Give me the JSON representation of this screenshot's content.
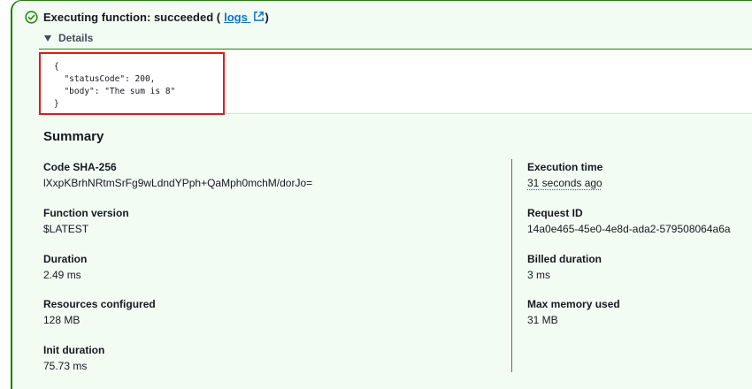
{
  "status": {
    "text": "Executing function: succeeded (",
    "link_label": "logs",
    "suffix": ")",
    "icon": "check-circle-icon",
    "external_icon": "external-link-icon"
  },
  "details": {
    "label": "Details"
  },
  "code": {
    "lines": "{\n  \"statusCode\": 200,\n  \"body\": \"The sum is 8\"\n}"
  },
  "summary": {
    "title": "Summary",
    "left": [
      {
        "label": "Code SHA-256",
        "value": "lXxpKBrhNRtmSrFg9wLdndYPph+QaMph0mchM/dorJo="
      },
      {
        "label": "Function version",
        "value": "$LATEST"
      },
      {
        "label": "Duration",
        "value": "2.49 ms"
      },
      {
        "label": "Resources configured",
        "value": "128 MB"
      },
      {
        "label": "Init duration",
        "value": "75.73 ms"
      }
    ],
    "right": [
      {
        "label": "Execution time",
        "value": "31 seconds ago"
      },
      {
        "label": "Request ID",
        "value": "14a0e465-45e0-4e8d-ada2-579508064a6a"
      },
      {
        "label": "Billed duration",
        "value": "3 ms"
      },
      {
        "label": "Max memory used",
        "value": "31 MB"
      }
    ]
  },
  "colors": {
    "success": "#1d8102",
    "panel_bg": "#f2fcf3",
    "link": "#0972d3",
    "highlight": "#e01b1b"
  }
}
